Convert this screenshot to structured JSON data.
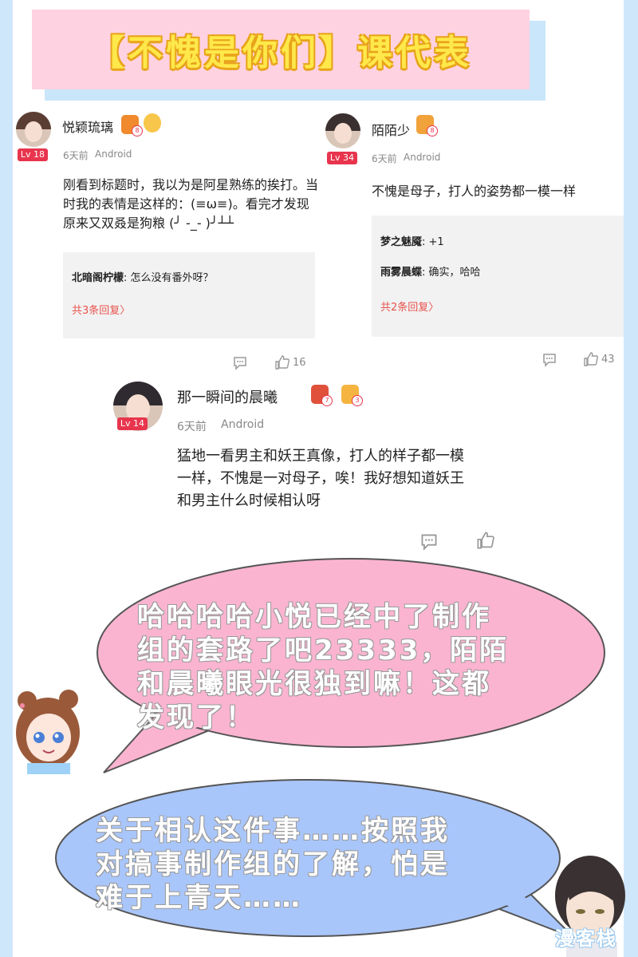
{
  "title": "【不愧是你们】课代表",
  "comments": [
    {
      "user": "悦颖琉璃",
      "level": "Lv 18",
      "badges": [
        {
          "icon": "gamepad-icon",
          "num": "8"
        },
        {
          "icon": "medal-icon",
          "num": ""
        }
      ],
      "time": "6天前",
      "platform": "Android",
      "text": [
        "刚看到标题时，我以为是阿星熟练的挨打。当",
        "时我的表情是这样的：(≡ω≡)。看完才发现",
        "原来又双叒是狗粮 (╯ -_- )╯┴┴"
      ],
      "replies": [
        {
          "name": "北暗阁柠檬",
          "text": ": 怎么没有番外呀？"
        }
      ],
      "more": "共3条回复〉",
      "likes": "16"
    },
    {
      "user": "陌陌少",
      "level": "Lv 34",
      "badges": [
        {
          "icon": "gift-icon",
          "num": "8"
        }
      ],
      "time": "6天前",
      "platform": "Android",
      "text": [
        "不愧是母子，打人的姿势都一模一样"
      ],
      "replies": [
        {
          "name": "梦之魅魇",
          "text": ": +1"
        },
        {
          "name": "雨雾晨蝶",
          "text": ": 确实，哈哈"
        }
      ],
      "more": "共2条回复〉",
      "likes": "43"
    },
    {
      "user": "那一瞬间的晨曦",
      "level": "Lv 14",
      "badges": [
        {
          "icon": "books-icon",
          "num": "7"
        },
        {
          "icon": "trophy-icon",
          "num": "3"
        }
      ],
      "time": "6天前",
      "platform": "Android",
      "text": [
        "猛地一看男主和妖王真像，打人的样子都一模",
        "一样，不愧是一对母子，唉！我好想知道妖王",
        "和男主什么时候相认呀"
      ],
      "likes": ""
    }
  ],
  "bubbles": [
    {
      "color": "#fbb4d0",
      "lines": [
        "哈哈哈哈小悦已经中了制作",
        "组的套路了吧23333，陌陌",
        "和晨曦眼光很独到嘛！这都",
        "发现了！"
      ]
    },
    {
      "color": "#a9c6fb",
      "lines": [
        "关于相认这件事……按照我",
        "对搞事制作组的了解，怕是",
        "难于上青天……"
      ]
    }
  ],
  "watermark": "漫客栈"
}
